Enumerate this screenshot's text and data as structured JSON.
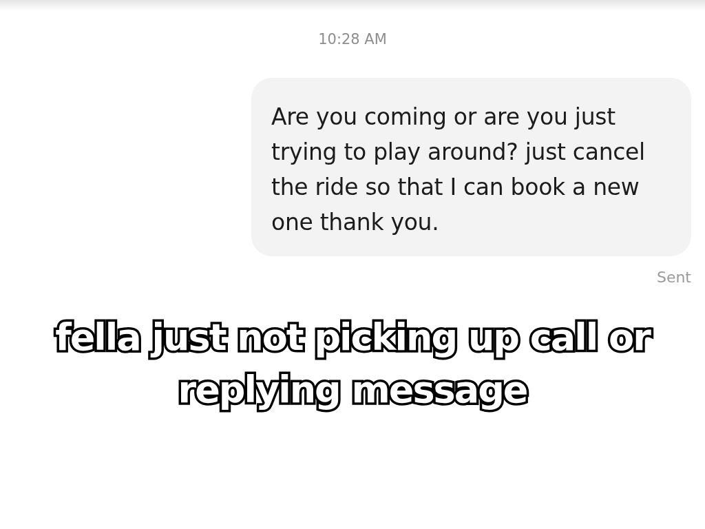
{
  "conversation": {
    "timestamp": "10:28 AM",
    "messages": [
      {
        "kind": "outgoing",
        "text": "Are you coming or are you just trying to play around? just cancel the ride so that I can book a new one thank you.",
        "status": "Sent"
      }
    ]
  },
  "caption": "fella just not picking up call or replying message"
}
